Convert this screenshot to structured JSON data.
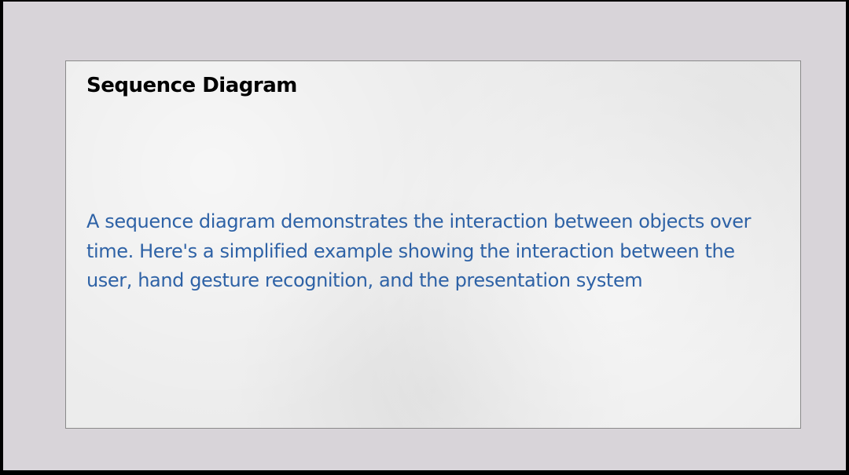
{
  "slide": {
    "title": "Sequence Diagram",
    "body": "A sequence diagram demonstrates the interaction between objects over time. Here's a simplified example showing the interaction between the user, hand gesture recognition, and the presentation system"
  },
  "colors": {
    "background": "#d8d4d9",
    "title": "#000000",
    "body_text": "#2e62a6"
  }
}
